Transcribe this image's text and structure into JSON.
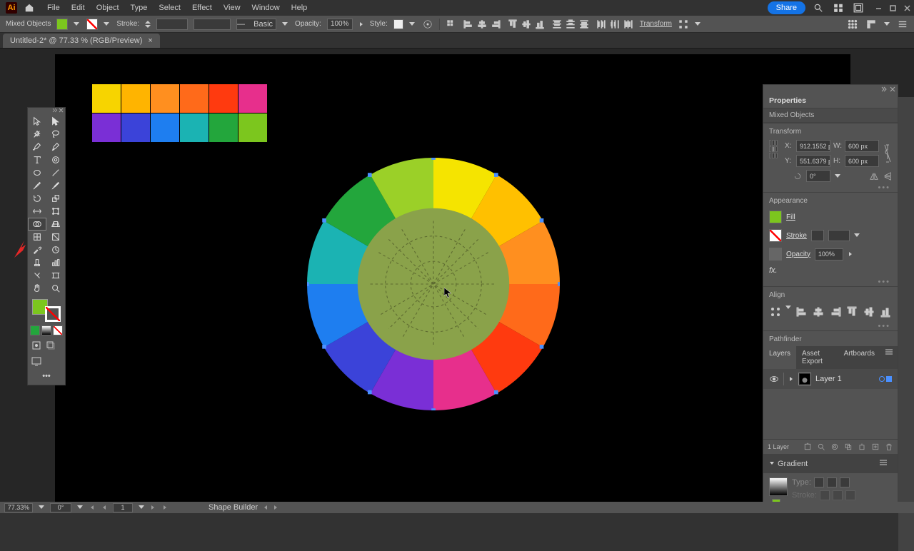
{
  "menu": [
    "File",
    "Edit",
    "Object",
    "Type",
    "Select",
    "Effect",
    "View",
    "Window",
    "Help"
  ],
  "share": "Share",
  "controlbar": {
    "label": "Mixed Objects",
    "stroke_lbl": "Stroke:",
    "basic": "Basic",
    "opacity_lbl": "Opacity:",
    "opacity": "100%",
    "style_lbl": "Style:",
    "transform": "Transform",
    "link": "∞"
  },
  "tab": {
    "title": "Untitled-2* @ 77.33 % (RGB/Preview)",
    "close": "×"
  },
  "palette_colors": [
    "#f7d400",
    "#ffb400",
    "#ff8f1f",
    "#ff6a1a",
    "#ff3a0f",
    "#e72f8c",
    "#7a2fd6",
    "#3b43d9",
    "#1e7ef0",
    "#1bb3b3",
    "#23a63c",
    "#7cc61e"
  ],
  "wheel": {
    "center": "#8aa24a",
    "segments": [
      {
        "c": "#9bd028"
      },
      {
        "c": "#f5e400"
      },
      {
        "c": "#ffc000"
      },
      {
        "c": "#ff8f1f"
      },
      {
        "c": "#ff6a1a"
      },
      {
        "c": "#ff3a0f"
      },
      {
        "c": "#e72f8c"
      },
      {
        "c": "#7a2fd6"
      },
      {
        "c": "#3b43d9"
      },
      {
        "c": "#1e7ef0"
      },
      {
        "c": "#1bb3b3"
      },
      {
        "c": "#23a63c"
      }
    ]
  },
  "fill_color": "#7cc61e",
  "props": {
    "title": "Properties",
    "sub": "Mixed Objects",
    "transform": "Transform",
    "x": "912.1552 p",
    "y": "551.6379 p",
    "w": "600 px",
    "h": "600 px",
    "rot": "0°",
    "appearance": "Appearance",
    "fill": "Fill",
    "stroke": "Stroke",
    "opacity_lbl": "Opacity",
    "opacity": "100%",
    "fx": "fx.",
    "align": "Align",
    "pathfinder": "Pathfinder",
    "tabs": [
      "Layers",
      "Asset Export",
      "Artboards"
    ],
    "layer_name": "Layer 1",
    "layer_count": "1 Layer",
    "gradient": "Gradient",
    "gr_type": "Type:",
    "gr_stroke": "Stroke:"
  },
  "status": {
    "zoom": "77.33%",
    "rot": "0°",
    "page": "1",
    "tool": "Shape Builder"
  }
}
